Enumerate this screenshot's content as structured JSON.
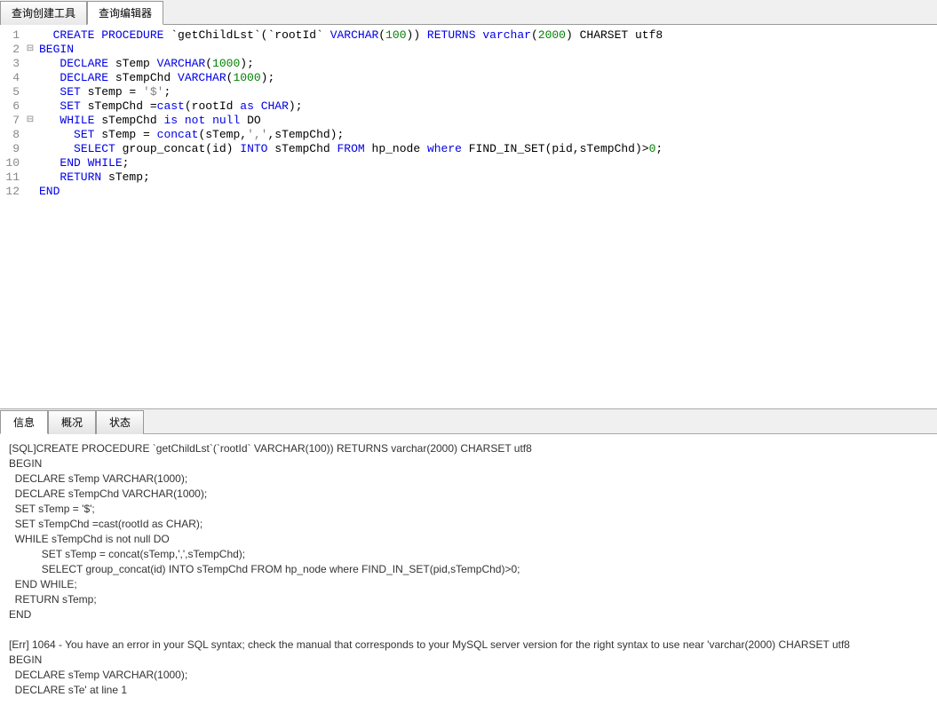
{
  "topTabs": {
    "builder": "查询创建工具",
    "editor": "查询编辑器"
  },
  "code": {
    "lines": [
      {
        "n": 1,
        "fold": "",
        "tokens": [
          [
            "  ",
            ""
          ],
          [
            "CREATE",
            "kw"
          ],
          [
            " ",
            ""
          ],
          [
            "PROCEDURE",
            "kw"
          ],
          [
            " `getChildLst`(`rootId` ",
            ""
          ],
          [
            "VARCHAR",
            "kw"
          ],
          [
            "(",
            ""
          ],
          [
            "100",
            "num"
          ],
          [
            ")) ",
            ""
          ],
          [
            "RETURNS",
            "kw"
          ],
          [
            " ",
            ""
          ],
          [
            "varchar",
            "kw"
          ],
          [
            "(",
            ""
          ],
          [
            "2000",
            "num"
          ],
          [
            ") ",
            ""
          ],
          [
            "CHARSET",
            "ident"
          ],
          [
            " utf8",
            ""
          ]
        ]
      },
      {
        "n": 2,
        "fold": "⊟",
        "tokens": [
          [
            "BEGIN",
            "kw"
          ]
        ]
      },
      {
        "n": 3,
        "fold": "",
        "tokens": [
          [
            "   ",
            ""
          ],
          [
            "DECLARE",
            "kw"
          ],
          [
            " sTemp ",
            ""
          ],
          [
            "VARCHAR",
            "kw"
          ],
          [
            "(",
            ""
          ],
          [
            "1000",
            "num"
          ],
          [
            ");",
            ""
          ]
        ]
      },
      {
        "n": 4,
        "fold": "",
        "tokens": [
          [
            "   ",
            ""
          ],
          [
            "DECLARE",
            "kw"
          ],
          [
            " sTempChd ",
            ""
          ],
          [
            "VARCHAR",
            "kw"
          ],
          [
            "(",
            ""
          ],
          [
            "1000",
            "num"
          ],
          [
            ");",
            ""
          ]
        ]
      },
      {
        "n": 5,
        "fold": "",
        "tokens": [
          [
            "   ",
            ""
          ],
          [
            "SET",
            "kw"
          ],
          [
            " sTemp = ",
            ""
          ],
          [
            "'$'",
            "str"
          ],
          [
            ";",
            ""
          ]
        ]
      },
      {
        "n": 6,
        "fold": "",
        "tokens": [
          [
            "   ",
            ""
          ],
          [
            "SET",
            "kw"
          ],
          [
            " sTempChd =",
            ""
          ],
          [
            "cast",
            "kw"
          ],
          [
            "(rootId ",
            ""
          ],
          [
            "as",
            "kw"
          ],
          [
            " ",
            ""
          ],
          [
            "CHAR",
            "kw"
          ],
          [
            ");",
            ""
          ]
        ]
      },
      {
        "n": 7,
        "fold": "⊟",
        "tokens": [
          [
            "   ",
            ""
          ],
          [
            "WHILE",
            "kw"
          ],
          [
            " sTempChd ",
            ""
          ],
          [
            "is",
            "kw"
          ],
          [
            " ",
            ""
          ],
          [
            "not",
            "kw"
          ],
          [
            " ",
            ""
          ],
          [
            "null",
            "kw"
          ],
          [
            " DO",
            ""
          ]
        ]
      },
      {
        "n": 8,
        "fold": "",
        "tokens": [
          [
            "     ",
            ""
          ],
          [
            "SET",
            "kw"
          ],
          [
            " sTemp = ",
            ""
          ],
          [
            "concat",
            "kw"
          ],
          [
            "(sTemp,",
            ""
          ],
          [
            "','",
            "str"
          ],
          [
            ",sTempChd);",
            ""
          ]
        ]
      },
      {
        "n": 9,
        "fold": "",
        "tokens": [
          [
            "     ",
            ""
          ],
          [
            "SELECT",
            "kw"
          ],
          [
            " group_concat(id) ",
            ""
          ],
          [
            "INTO",
            "kw"
          ],
          [
            " sTempChd ",
            ""
          ],
          [
            "FROM",
            "kw"
          ],
          [
            " hp_node ",
            ""
          ],
          [
            "where",
            "kw"
          ],
          [
            " FIND_IN_SET(pid,sTempChd)>",
            ""
          ],
          [
            "0",
            "num"
          ],
          [
            ";",
            ""
          ]
        ]
      },
      {
        "n": 10,
        "fold": "",
        "tokens": [
          [
            "   ",
            ""
          ],
          [
            "END",
            "kw"
          ],
          [
            " ",
            ""
          ],
          [
            "WHILE",
            "kw"
          ],
          [
            ";",
            ""
          ]
        ]
      },
      {
        "n": 11,
        "fold": "",
        "tokens": [
          [
            "   ",
            ""
          ],
          [
            "RETURN",
            "kw"
          ],
          [
            " sTemp;",
            ""
          ]
        ]
      },
      {
        "n": 12,
        "fold": "",
        "tokens": [
          [
            "END",
            "kw"
          ]
        ]
      }
    ]
  },
  "panelTabs": {
    "info": "信息",
    "profile": "概况",
    "status": "状态"
  },
  "output": "[SQL]CREATE PROCEDURE `getChildLst`(`rootId` VARCHAR(100)) RETURNS varchar(2000) CHARSET utf8\nBEGIN\n  DECLARE sTemp VARCHAR(1000);\n  DECLARE sTempChd VARCHAR(1000);\n  SET sTemp = '$';\n  SET sTempChd =cast(rootId as CHAR);\n  WHILE sTempChd is not null DO\n           SET sTemp = concat(sTemp,',',sTempChd);\n           SELECT group_concat(id) INTO sTempChd FROM hp_node where FIND_IN_SET(pid,sTempChd)>0;\n  END WHILE;\n  RETURN sTemp;\nEND\n\n[Err] 1064 - You have an error in your SQL syntax; check the manual that corresponds to your MySQL server version for the right syntax to use near 'varchar(2000) CHARSET utf8\nBEGIN\n  DECLARE sTemp VARCHAR(1000);\n  DECLARE sTe' at line 1"
}
